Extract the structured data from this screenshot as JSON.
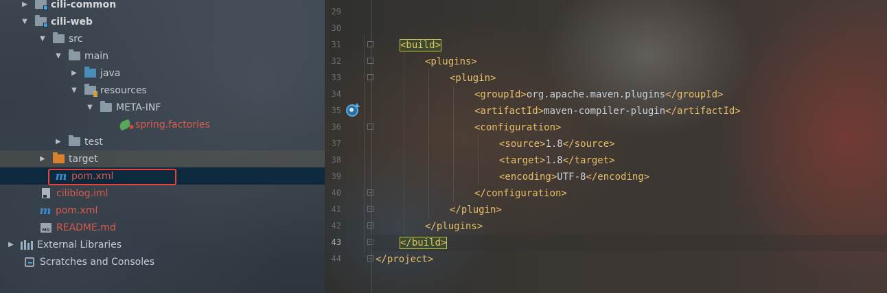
{
  "tree": {
    "items": [
      {
        "label": "cili-common",
        "style": "bold"
      },
      {
        "label": "cili-web",
        "style": "bold"
      },
      {
        "label": "src"
      },
      {
        "label": "main"
      },
      {
        "label": "java"
      },
      {
        "label": "resources"
      },
      {
        "label": "META-INF"
      },
      {
        "label": "spring.factories"
      },
      {
        "label": "test"
      },
      {
        "label": "target"
      },
      {
        "label": "pom.xml"
      },
      {
        "label": "ciliblog.iml"
      },
      {
        "label": "pom.xml"
      },
      {
        "label": "README.md"
      },
      {
        "label": "External Libraries"
      },
      {
        "label": "Scratches and Consoles"
      }
    ]
  },
  "editor": {
    "line_numbers": [
      "29",
      "30",
      "31",
      "32",
      "33",
      "34",
      "35",
      "36",
      "37",
      "38",
      "39",
      "40",
      "41",
      "42",
      "43",
      "44"
    ],
    "current_line": "43",
    "lines": [
      {
        "parts": []
      },
      {
        "parts": []
      },
      {
        "parts": [
          {
            "t": "<build>",
            "k": "tag"
          }
        ]
      },
      {
        "parts": [
          {
            "t": "<plugins>",
            "k": "tag"
          }
        ]
      },
      {
        "parts": [
          {
            "t": "<plugin>",
            "k": "tag"
          }
        ]
      },
      {
        "parts": [
          {
            "t": "<groupId>",
            "k": "tag"
          },
          {
            "t": "org.apache.maven.plugins",
            "k": "txt"
          },
          {
            "t": "</groupId>",
            "k": "tag"
          }
        ]
      },
      {
        "parts": [
          {
            "t": "<artifactId>",
            "k": "tag"
          },
          {
            "t": "maven-compiler-plugin",
            "k": "txt"
          },
          {
            "t": "</artifactId>",
            "k": "tag"
          }
        ]
      },
      {
        "parts": [
          {
            "t": "<configuration>",
            "k": "tag"
          }
        ]
      },
      {
        "parts": [
          {
            "t": "<source>",
            "k": "tag"
          },
          {
            "t": "1.8",
            "k": "txt"
          },
          {
            "t": "</source>",
            "k": "tag"
          }
        ]
      },
      {
        "parts": [
          {
            "t": "<target>",
            "k": "tag"
          },
          {
            "t": "1.8",
            "k": "txt"
          },
          {
            "t": "</target>",
            "k": "tag"
          }
        ]
      },
      {
        "parts": [
          {
            "t": "<encoding>",
            "k": "tag"
          },
          {
            "t": "UTF-8",
            "k": "txt"
          },
          {
            "t": "</encoding>",
            "k": "tag"
          }
        ]
      },
      {
        "parts": [
          {
            "t": "</configuration>",
            "k": "tag"
          }
        ]
      },
      {
        "parts": [
          {
            "t": "</plugin>",
            "k": "tag"
          }
        ]
      },
      {
        "parts": [
          {
            "t": "</plugins>",
            "k": "tag"
          }
        ]
      },
      {
        "parts": [
          {
            "t": "</build>",
            "k": "tag"
          }
        ]
      },
      {
        "parts": [
          {
            "t": "</project>",
            "k": "tag"
          }
        ]
      }
    ]
  },
  "colors": {
    "tag": "#e8bf6a",
    "text": "#c9d1d9",
    "selection": "#0d293e",
    "highlight_box": "#e8433a",
    "maven_icon": "#3f8fd2",
    "red_file_text": "#d95b4c"
  }
}
